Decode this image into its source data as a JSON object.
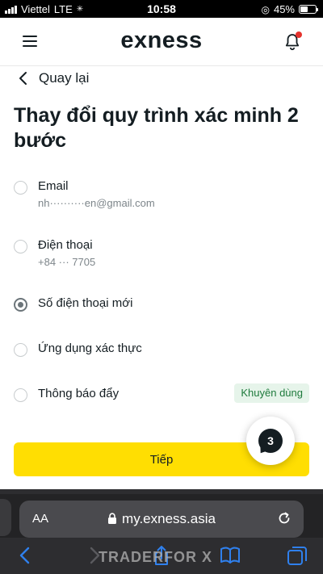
{
  "status_bar": {
    "carrier": "Viettel",
    "network": "LTE",
    "time": "10:58",
    "battery": "45%",
    "battery_level": 0.45
  },
  "header": {
    "logo": "exness",
    "menu_icon": "hamburger-icon",
    "bell_icon": "bell-icon",
    "notification_dot_color": "#e5322d"
  },
  "back": {
    "label": "Quay lại"
  },
  "title": "Thay đổi quy trình xác minh 2 bước",
  "options": [
    {
      "label": "Email",
      "detail": "nh··········en@gmail.com",
      "selected": false
    },
    {
      "label": "Điện thoại",
      "detail": "+84 ··· 7705",
      "selected": false
    },
    {
      "label": "Số điện thoại mới",
      "selected": true
    },
    {
      "label": "Ứng dụng xác thực",
      "selected": false
    },
    {
      "label": "Thông báo đẩy",
      "badge": "Khuyên dùng",
      "selected": false
    }
  ],
  "continue": {
    "label": "Tiếp",
    "color": "#ffde02"
  },
  "chat_badge": {
    "count": "3"
  },
  "browser": {
    "aa_label": "AA",
    "url": "my.exness.asia"
  },
  "watermark": "TRADERFOR X"
}
